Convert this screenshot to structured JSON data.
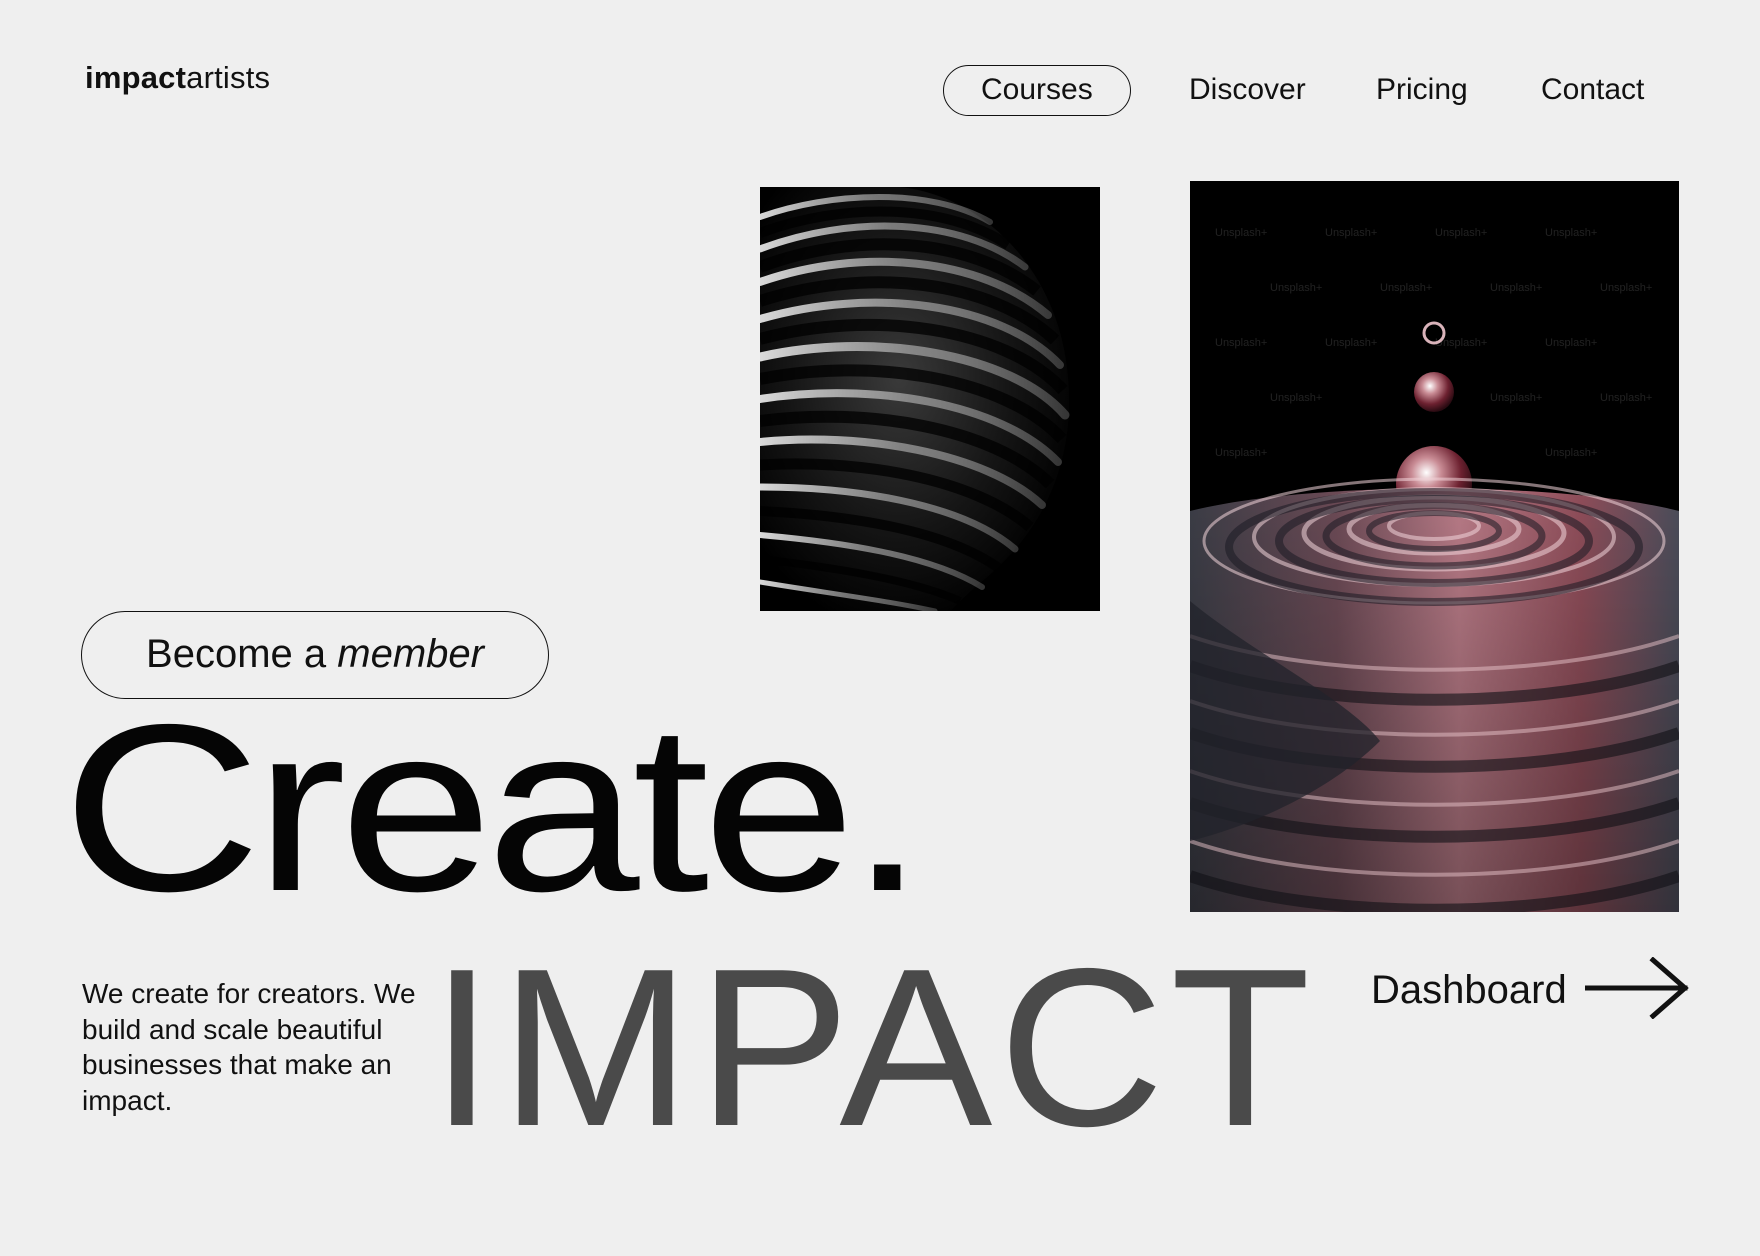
{
  "brand": {
    "name_bold": "impact",
    "name_light": "artists"
  },
  "nav": {
    "items": [
      {
        "label": "Courses",
        "active": true
      },
      {
        "label": "Discover",
        "active": false
      },
      {
        "label": "Pricing",
        "active": false
      },
      {
        "label": "Contact",
        "active": false
      }
    ]
  },
  "hero": {
    "member_button": {
      "prefix": "Become a",
      "emphasis": "member"
    },
    "headline": "Create.",
    "tagline": "We create for creators. We build and scale beautiful businesses that make an impact.",
    "big_word": "IMPACT",
    "dashboard_link": "Dashboard",
    "dashboard_icon": "arrow-right-icon"
  },
  "images": {
    "left": "ribbed-sphere-image",
    "right": "liquid-drop-image",
    "watermark_text": "Unsplash+"
  },
  "colors": {
    "background": "#efefef",
    "text": "#111111",
    "big_word": "#4a4a4a",
    "image_background": "#000000",
    "liquid_accent": "#8e4d59"
  }
}
